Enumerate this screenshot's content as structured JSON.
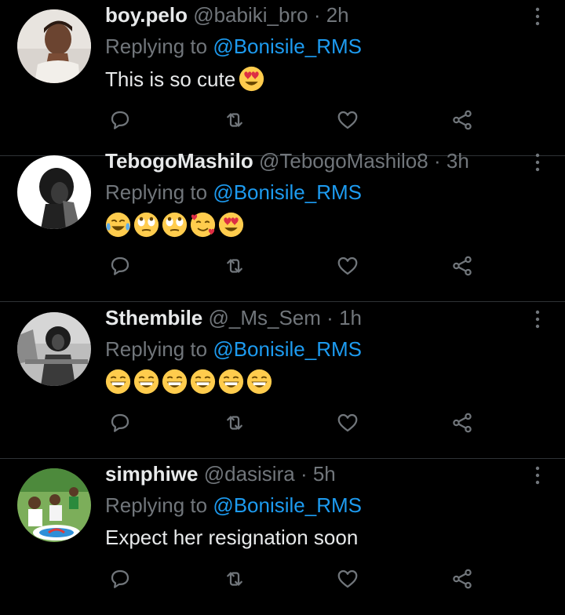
{
  "colors": {
    "background": "#000000",
    "primary_text": "#e7e9ea",
    "secondary_text": "#71767b",
    "mention": "#1d9bf0",
    "divider": "#2f3336"
  },
  "tweets": [
    {
      "display_name": "boy.pelo",
      "handle": "@babiki_bro",
      "separator": "·",
      "time": "2h",
      "replying_prefix": "Replying to",
      "replying_to": "@Bonisile_RMS",
      "text": "This is so cute",
      "emojis": [
        "heart-eyes"
      ]
    },
    {
      "display_name": "TebogoMashilo",
      "handle": "@TebogoMashilo8",
      "separator": "·",
      "time": "3h",
      "replying_prefix": "Replying to",
      "replying_to": "@Bonisile_RMS",
      "text": "",
      "emojis": [
        "tears-of-joy",
        "rolling-eyes",
        "rolling-eyes",
        "smiling-with-hearts",
        "heart-eyes"
      ]
    },
    {
      "display_name": "Sthembile",
      "handle": "@_Ms_Sem",
      "separator": "·",
      "time": "1h",
      "replying_prefix": "Replying to",
      "replying_to": "@Bonisile_RMS",
      "text": "",
      "emojis": [
        "grinning-squinting",
        "grinning-squinting",
        "grinning-squinting",
        "grinning-squinting",
        "grinning-squinting",
        "grinning-squinting"
      ]
    },
    {
      "display_name": "simphiwe",
      "handle": "@dasisira",
      "separator": "·",
      "time": "5h",
      "replying_prefix": "Replying to",
      "replying_to": "@Bonisile_RMS",
      "text": "Expect her resignation soon",
      "emojis": []
    }
  ],
  "action_icons": [
    "reply-icon",
    "retweet-icon",
    "like-icon",
    "share-icon"
  ],
  "more_icon": "more-vertical-icon"
}
